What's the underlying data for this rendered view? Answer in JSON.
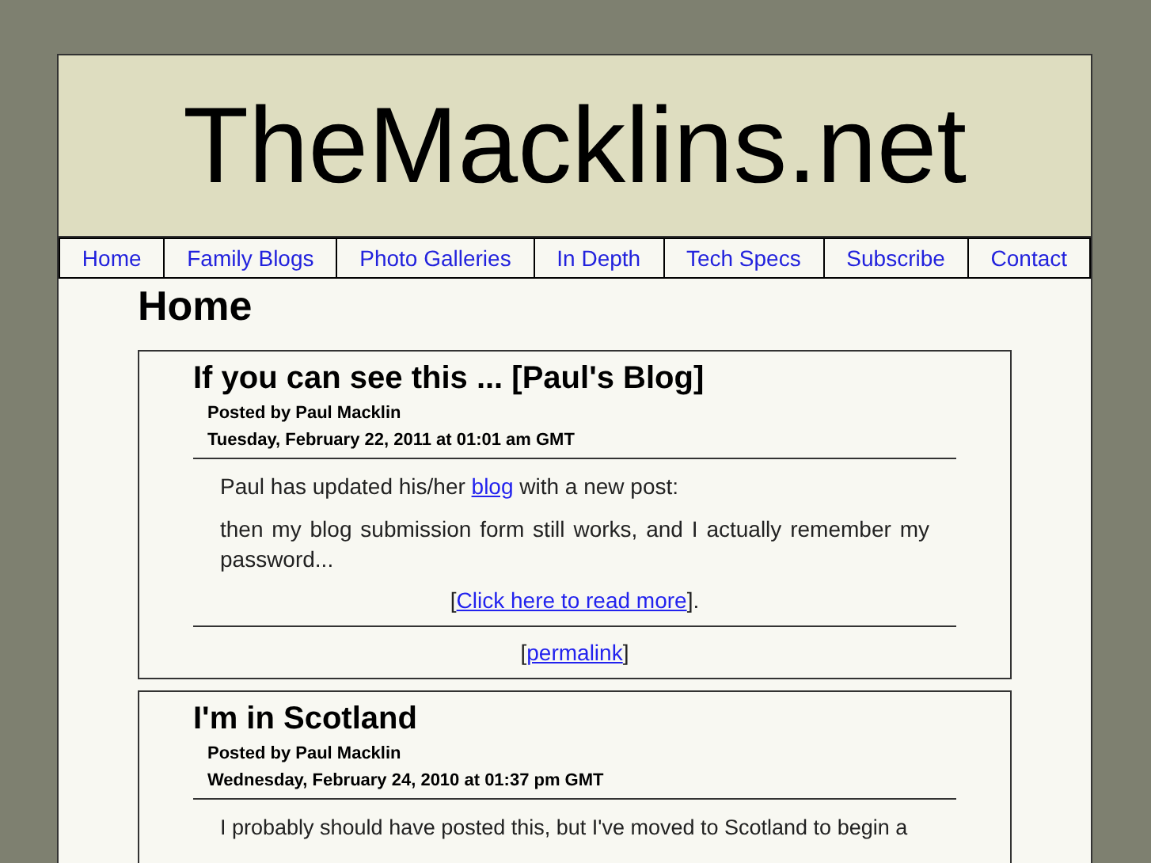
{
  "site_title": "TheMacklins.net",
  "nav": [
    "Home",
    "Family Blogs",
    "Photo Galleries",
    "In Depth",
    "Tech Specs",
    "Subscribe",
    "Contact"
  ],
  "page_heading": "Home",
  "posts": [
    {
      "title": "If you can see this ... [Paul's Blog]",
      "posted_by": "Posted by Paul Macklin",
      "date": "Tuesday, February 22, 2011 at 01:01 am GMT",
      "intro": {
        "before": "Paul has updated his/her",
        "link": "blog",
        "after": "with a new post:"
      },
      "excerpt": "then my blog submission form still works, and I actually remember my password...",
      "read_more": {
        "before": "[",
        "link": "Click here to read more",
        "after": "]."
      },
      "permalink": {
        "before": "[",
        "link": "permalink",
        "after": "]"
      }
    },
    {
      "title": "I'm in Scotland",
      "posted_by": "Posted by Paul Macklin",
      "date": "Wednesday, February 24, 2010 at 01:37 pm GMT",
      "body": "I probably should have posted this, but I've moved to Scotland to begin a"
    }
  ]
}
